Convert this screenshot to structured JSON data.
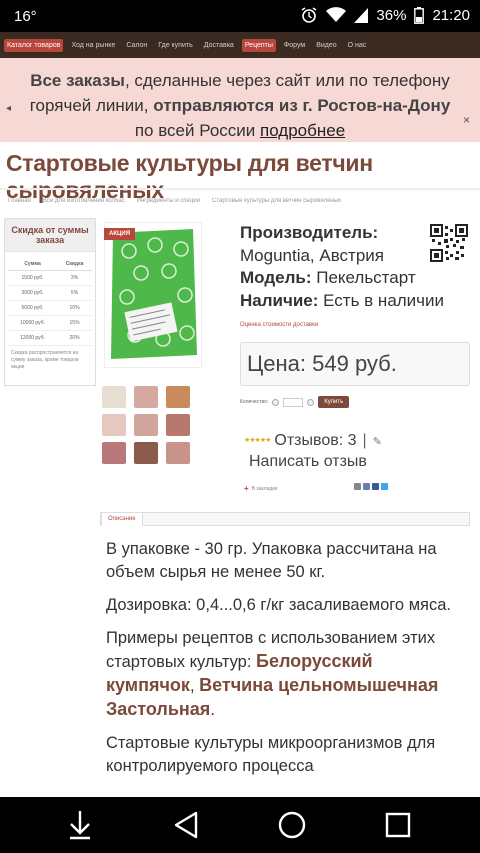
{
  "statusbar": {
    "left": "16°",
    "battery": "36%",
    "time": "21:20"
  },
  "nav": {
    "items": [
      "Каталог товаров",
      "Ход на рынке",
      "Салон",
      "Где купить",
      "Доставка",
      "Рецепты",
      "Форум",
      "Видео",
      "О нас"
    ]
  },
  "notice": {
    "part1": "Все заказы",
    "part2": ", сделанные через сайт или по телефону горячей линии, ",
    "part3": "отправляются из г. Ростов-на-Дону",
    "part4": " по всей России ",
    "link": "подробнее",
    "close": "×"
  },
  "page": {
    "title": "Стартовые культуры для ветчин сыровяленых"
  },
  "breadcrumb": {
    "items": [
      "Главная",
      "Все для изготовления колбас",
      "Ингредиенты и специи",
      "Стартовые культуры для ветчин сыровяленых"
    ]
  },
  "discount": {
    "title": "Скидка от суммы заказа",
    "col_sum": "Сумма",
    "col_disc": "Скидка",
    "rows": [
      {
        "sum": "1500 руб.",
        "disc": "3%"
      },
      {
        "sum": "3000 руб.",
        "disc": "5%"
      },
      {
        "sum": "5000 руб.",
        "disc": "10%"
      },
      {
        "sum": "10000 руб.",
        "disc": "15%"
      },
      {
        "sum": "12000 руб.",
        "disc": "20%"
      }
    ],
    "note": "Скидка распространяется на сумму заказа, кроме товаров акции"
  },
  "product": {
    "badge": "АКЦИЯ",
    "manufacturer_label": "Производитель:",
    "manufacturer": "Moguntia, Австрия",
    "model_label": "Модель:",
    "model": "Пекельстарт",
    "availability_label": "Наличие:",
    "availability": "Есть в наличии",
    "calc_link": "Оценка стоимости доставки",
    "price": "Цена: 549 руб.",
    "qty_label": "Количество:",
    "buy": "Купить",
    "reviews": "Отзывов: 3",
    "write_review": "Написать отзыв",
    "favorites": "В закладки",
    "tab": "Описание"
  },
  "colors": {
    "brown": "#7b4a3a",
    "accent": "#b8463a",
    "notice_bg": "#f6d8d4"
  },
  "description": {
    "p1": "В упаковке - 30 гр. Упаковка рассчитана на объем сырья не менее 50 кг.",
    "p2": "Дозировка: 0,4...0,6 г/кг  засаливаемого мяса.",
    "p3_before": "Примеры рецептов с использованием этих стартовых культур: ",
    "link1": "Белорусский кумпячок",
    "p3_mid": ", ",
    "link2": "Ветчина цельномышечная Застольная",
    "p3_after": ".",
    "p4": "Стартовые культуры микроорганизмов для контролируемого процесса"
  }
}
